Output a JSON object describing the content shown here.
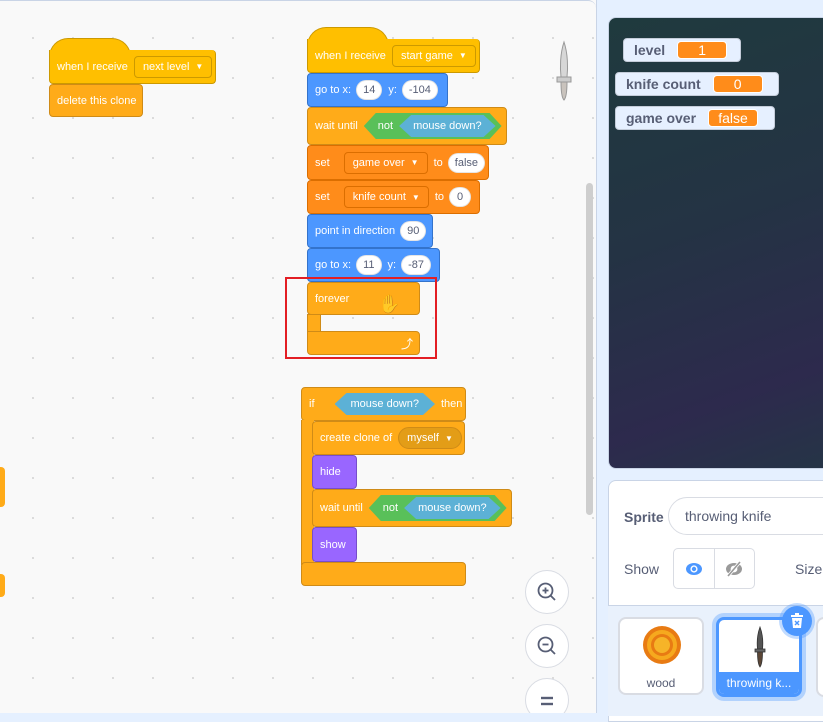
{
  "workspace": {
    "script1": {
      "hat": {
        "label": "when I receive",
        "message": "next level"
      },
      "delete_clone": "delete this clone"
    },
    "script2": {
      "hat": {
        "label": "when I receive",
        "message": "start game"
      },
      "goto1": {
        "label": "go to x:",
        "x": "14",
        "ylabel": "y:",
        "y": "-104"
      },
      "wait1": {
        "label": "wait until",
        "not": "not",
        "sensing": "mouse down?"
      },
      "set1": {
        "label": "set",
        "var": "game over",
        "to": "to",
        "value": "false"
      },
      "set2": {
        "label": "set",
        "var": "knife count",
        "to": "to",
        "value": "0"
      },
      "point": {
        "label": "point in direction",
        "value": "90"
      },
      "goto2": {
        "label": "go to x:",
        "x": "11",
        "ylabel": "y:",
        "y": "-87"
      },
      "forever": "forever"
    },
    "script3": {
      "if": {
        "label": "if",
        "sensing": "mouse down?",
        "then": "then"
      },
      "create_clone": {
        "label": "create clone of",
        "target": "myself"
      },
      "hide": "hide",
      "wait": {
        "label": "wait until",
        "not": "not",
        "sensing": "mouse down?"
      },
      "show": "show"
    },
    "zoom_controls": [
      "zoom-in",
      "zoom-out",
      "reset-zoom"
    ]
  },
  "stage": {
    "monitors": [
      {
        "name": "level",
        "value": "1"
      },
      {
        "name": "knife count",
        "value": "0"
      },
      {
        "name": "game over",
        "value": "false"
      }
    ]
  },
  "sprite_info": {
    "sprite_label": "Sprite",
    "sprite_name": "throwing knife",
    "show_label": "Show",
    "size_label": "Size"
  },
  "sprites": [
    {
      "name": "wood",
      "selected": false
    },
    {
      "name": "throwing k...",
      "selected": true
    }
  ],
  "colors": {
    "events": "#ffbf00",
    "control": "#ffab19",
    "motion": "#4c97ff",
    "variables": "#ff8c1a",
    "looks": "#9966ff",
    "selection": "#4c97ff",
    "highlight": "#e31e24"
  }
}
